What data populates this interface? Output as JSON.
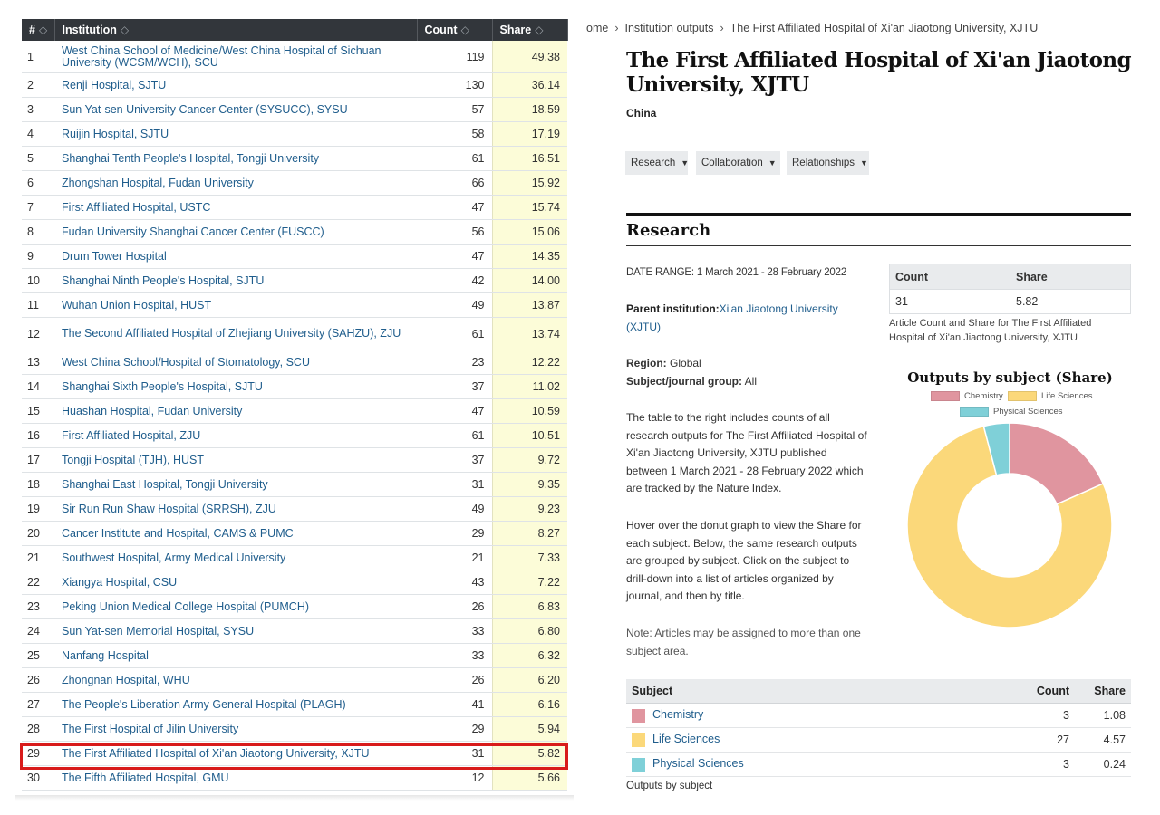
{
  "ranking_table": {
    "headers": {
      "rank": "#",
      "institution": "Institution",
      "count": "Count",
      "share": "Share"
    },
    "rows": [
      {
        "rank": "1",
        "institution": "West China School of Medicine/West China Hospital of Sichuan University (WCSM/WCH), SCU",
        "count": "119",
        "share": "49.38",
        "tall": true
      },
      {
        "rank": "2",
        "institution": "Renji Hospital, SJTU",
        "count": "130",
        "share": "36.14"
      },
      {
        "rank": "3",
        "institution": "Sun Yat-sen University Cancer Center (SYSUCC), SYSU",
        "count": "57",
        "share": "18.59"
      },
      {
        "rank": "4",
        "institution": "Ruijin Hospital, SJTU",
        "count": "58",
        "share": "17.19"
      },
      {
        "rank": "5",
        "institution": "Shanghai Tenth People's Hospital, Tongji University",
        "count": "61",
        "share": "16.51"
      },
      {
        "rank": "6",
        "institution": "Zhongshan Hospital, Fudan University",
        "count": "66",
        "share": "15.92"
      },
      {
        "rank": "7",
        "institution": "First Affiliated Hospital, USTC",
        "count": "47",
        "share": "15.74"
      },
      {
        "rank": "8",
        "institution": "Fudan University Shanghai Cancer Center (FUSCC)",
        "count": "56",
        "share": "15.06"
      },
      {
        "rank": "9",
        "institution": "Drum Tower Hospital",
        "count": "47",
        "share": "14.35"
      },
      {
        "rank": "10",
        "institution": "Shanghai Ninth People's Hospital, SJTU",
        "count": "42",
        "share": "14.00"
      },
      {
        "rank": "11",
        "institution": "Wuhan Union Hospital, HUST",
        "count": "49",
        "share": "13.87"
      },
      {
        "rank": "12",
        "institution": "The Second Affiliated Hospital of Zhejiang University (SAHZU), ZJU",
        "count": "61",
        "share": "13.74",
        "tall": true
      },
      {
        "rank": "13",
        "institution": "West China School/Hospital of Stomatology, SCU",
        "count": "23",
        "share": "12.22"
      },
      {
        "rank": "14",
        "institution": "Shanghai Sixth People's Hospital, SJTU",
        "count": "37",
        "share": "11.02"
      },
      {
        "rank": "15",
        "institution": "Huashan Hospital, Fudan University",
        "count": "47",
        "share": "10.59"
      },
      {
        "rank": "16",
        "institution": "First Affiliated Hospital, ZJU",
        "count": "61",
        "share": "10.51"
      },
      {
        "rank": "17",
        "institution": "Tongji Hospital (TJH), HUST",
        "count": "37",
        "share": "9.72"
      },
      {
        "rank": "18",
        "institution": "Shanghai East Hospital, Tongji University",
        "count": "31",
        "share": "9.35"
      },
      {
        "rank": "19",
        "institution": "Sir Run Run Shaw Hospital (SRRSH), ZJU",
        "count": "49",
        "share": "9.23"
      },
      {
        "rank": "20",
        "institution": "Cancer Institute and Hospital, CAMS & PUMC",
        "count": "29",
        "share": "8.27"
      },
      {
        "rank": "21",
        "institution": "Southwest Hospital, Army Medical University",
        "count": "21",
        "share": "7.33"
      },
      {
        "rank": "22",
        "institution": "Xiangya Hospital, CSU",
        "count": "43",
        "share": "7.22"
      },
      {
        "rank": "23",
        "institution": "Peking Union Medical College Hospital (PUMCH)",
        "count": "26",
        "share": "6.83"
      },
      {
        "rank": "24",
        "institution": "Sun Yat-sen Memorial Hospital, SYSU",
        "count": "33",
        "share": "6.80"
      },
      {
        "rank": "25",
        "institution": "Nanfang Hospital",
        "count": "33",
        "share": "6.32"
      },
      {
        "rank": "26",
        "institution": "Zhongnan Hospital, WHU",
        "count": "26",
        "share": "6.20"
      },
      {
        "rank": "27",
        "institution": "The People's Liberation Army General Hospital (PLAGH)",
        "count": "41",
        "share": "6.16"
      },
      {
        "rank": "28",
        "institution": "The First Hospital of Jilin University",
        "count": "29",
        "share": "5.94"
      },
      {
        "rank": "29",
        "institution": "The First Affiliated Hospital of Xi'an Jiaotong University, XJTU",
        "count": "31",
        "share": "5.82",
        "highlighted": true
      },
      {
        "rank": "30",
        "institution": "The Fifth Affiliated Hospital, GMU",
        "count": "12",
        "share": "5.66"
      }
    ]
  },
  "detail": {
    "breadcrumb": {
      "home": "ome",
      "outputs": "Institution outputs",
      "current": "The First Affiliated Hospital of Xi'an Jiaotong University, XJTU"
    },
    "title": "The First Affiliated Hospital of Xi'an Jiaotong University, XJTU",
    "country": "China",
    "tabs": {
      "research": "Research",
      "collaboration": "Collaboration",
      "relationships": "Relationships"
    },
    "section_title": "Research",
    "date_range": "DATE RANGE: 1 March 2021 - 28 February 2022",
    "parent_label": "Parent institution:",
    "parent_link": "Xi'an Jiaotong University (XJTU)",
    "region_label": "Region:",
    "region_value": "Global",
    "subject_group_label": "Subject/journal group:",
    "subject_group_value": "All",
    "description": "The table to the right includes counts of all research outputs for The First Affiliated Hospital of Xi'an Jiaotong University, XJTU published between 1 March 2021 - 28 February 2022 which are tracked by the Nature Index.",
    "hover_text": "Hover over the donut graph to view the Share for each subject. Below, the same research outputs are grouped by subject. Click on the subject to drill-down into a list of articles organized by journal, and then by title.",
    "note": "Note: Articles may be assigned to more than one subject area.",
    "summary": {
      "count_header": "Count",
      "share_header": "Share",
      "count": "31",
      "share": "5.82",
      "caption": "Article Count and Share for The First Affiliated Hospital of Xi'an Jiaotong University, XJTU"
    },
    "subject_table": {
      "headers": {
        "subject": "Subject",
        "count": "Count",
        "share": "Share"
      },
      "rows": [
        {
          "subject": "Chemistry",
          "count": "3",
          "share": "1.08",
          "color": "#e0959f"
        },
        {
          "subject": "Life Sciences",
          "count": "27",
          "share": "4.57",
          "color": "#fbd87a"
        },
        {
          "subject": "Physical Sciences",
          "count": "3",
          "share": "0.24",
          "color": "#7fd0d8"
        }
      ],
      "caption": "Outputs by subject"
    }
  },
  "chart_data": {
    "type": "pie",
    "donut": true,
    "title": "Outputs by subject (Share)",
    "categories": [
      "Chemistry",
      "Life Sciences",
      "Physical Sciences"
    ],
    "values": [
      1.08,
      4.57,
      0.24
    ],
    "colors": [
      "#e0959f",
      "#fbd87a",
      "#7fd0d8"
    ],
    "legend": "top"
  },
  "colors": {
    "table_header_bg": "#32363b",
    "share_column_bg": "#fcfcd8",
    "link": "#1f5d8c",
    "highlight_border": "#d81b1b"
  }
}
